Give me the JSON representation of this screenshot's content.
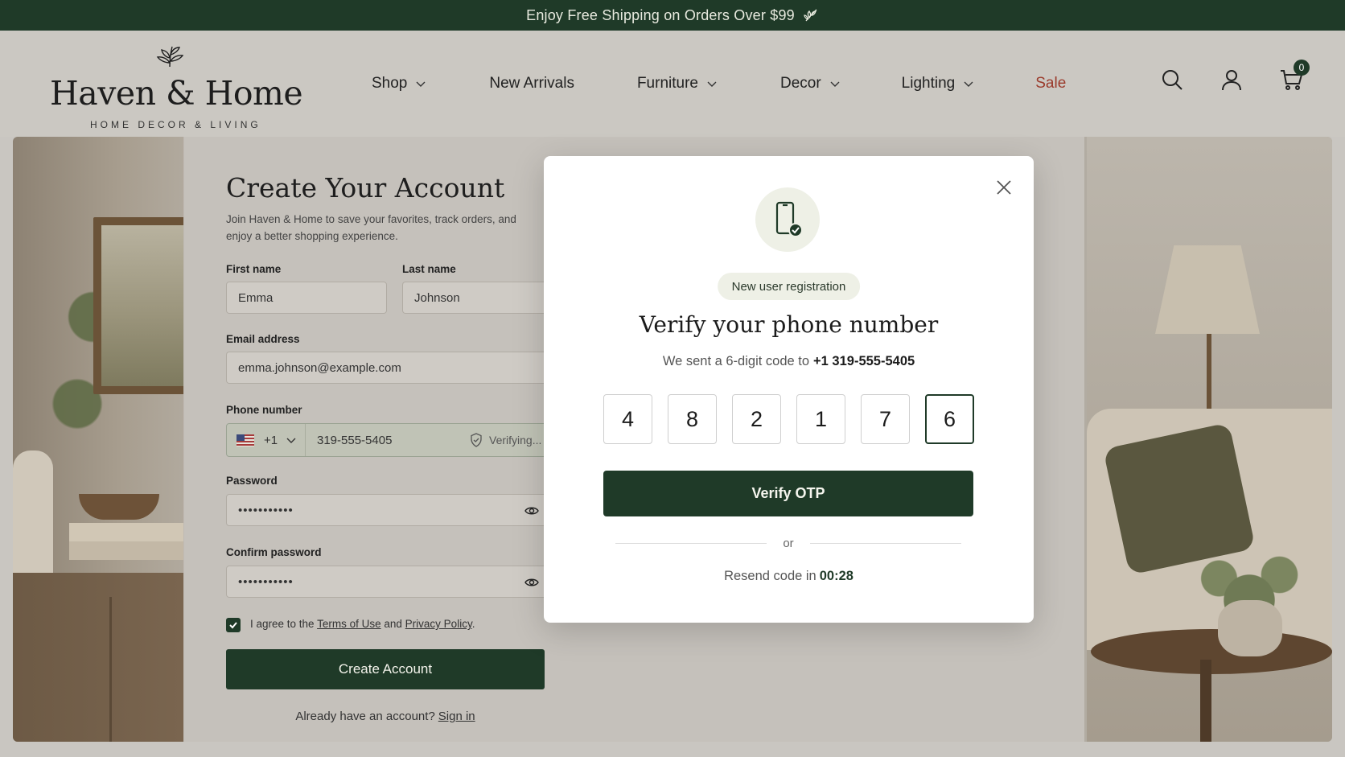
{
  "announcement": {
    "text": "Enjoy Free Shipping on Orders Over $99",
    "icon": "leaf-icon"
  },
  "brand": {
    "name": "Haven & Home",
    "tagline": "HOME DECOR & LIVING"
  },
  "nav": {
    "items": [
      {
        "label": "Shop",
        "has_dropdown": true
      },
      {
        "label": "New Arrivals",
        "has_dropdown": false
      },
      {
        "label": "Furniture",
        "has_dropdown": true
      },
      {
        "label": "Decor",
        "has_dropdown": true
      },
      {
        "label": "Lighting",
        "has_dropdown": true
      },
      {
        "label": "Sale",
        "has_dropdown": false
      }
    ]
  },
  "header_icons": {
    "search": "search-icon",
    "account": "user-icon",
    "cart": "cart-icon",
    "cart_count": "0"
  },
  "form": {
    "title": "Create Your Account",
    "subtitle": "Join Haven & Home to save your favorites, track orders, and enjoy a better shopping experience.",
    "first_name": {
      "label": "First name",
      "value": "Emma"
    },
    "last_name": {
      "label": "Last name",
      "value": "Johnson"
    },
    "email": {
      "label": "Email address",
      "value": "emma.johnson@example.com"
    },
    "phone": {
      "label": "Phone number",
      "country_code": "+1",
      "value": "319-555-5405",
      "status": "Verifying..."
    },
    "password": {
      "label": "Password",
      "value": "•••••••••••"
    },
    "confirm_password": {
      "label": "Confirm password",
      "value": "•••••••••••"
    },
    "agree": {
      "prefix": "I agree to the",
      "terms": "Terms of Use",
      "and": "and",
      "privacy": "Privacy Policy",
      "suffix": "."
    },
    "create_button": "Create Account",
    "signin_prompt": "Already have an account?",
    "signin_link": "Sign in"
  },
  "modal": {
    "badge": "New user registration",
    "title": "Verify your phone number",
    "subtitle_prefix": "We sent a 6-digit code to",
    "phone": "+1 319-555-5405",
    "otp_digits": [
      "4",
      "8",
      "2",
      "1",
      "7",
      "6"
    ],
    "verify_button": "Verify OTP",
    "or_text": "or",
    "resend_prefix": "Resend code in",
    "resend_timer": "00:28"
  },
  "colors": {
    "brand_green": "#1f3a28",
    "sale_red": "#9b3b2c"
  }
}
